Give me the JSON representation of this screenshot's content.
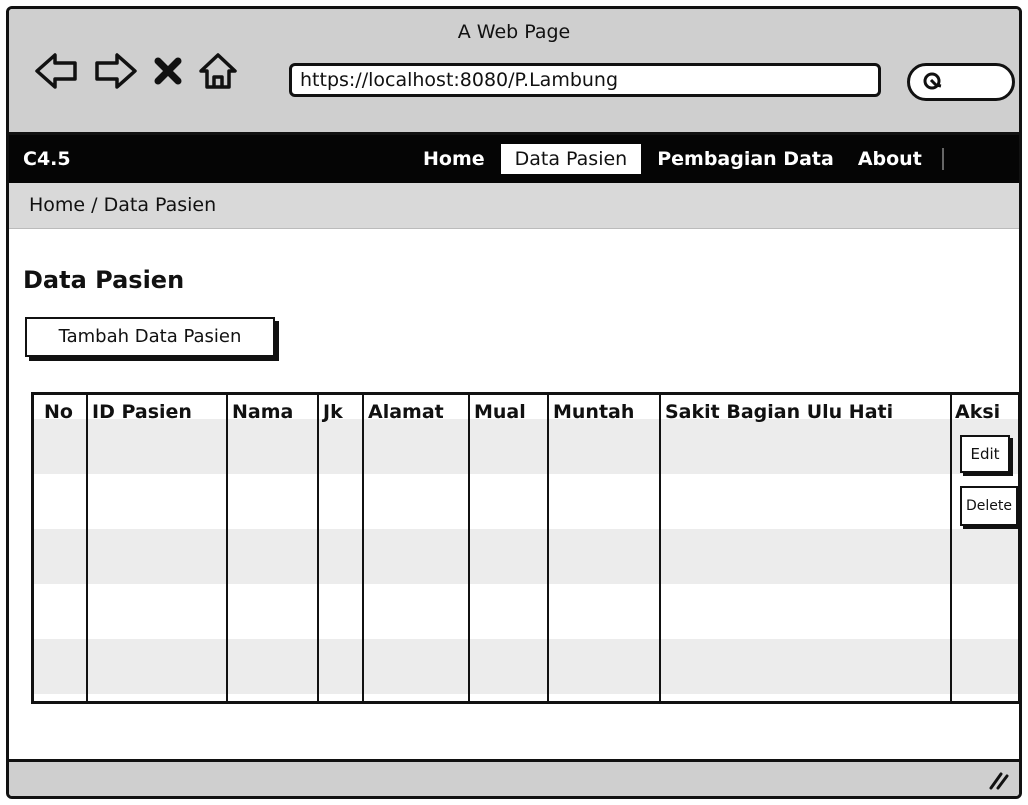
{
  "window": {
    "title": "A Web Page"
  },
  "browser": {
    "url": "https://localhost:8080/P.Lambung",
    "icons": [
      "back-arrow-icon",
      "forward-arrow-icon",
      "close-x-icon",
      "home-icon",
      "search-icon"
    ]
  },
  "navbar": {
    "brand": "C4.5",
    "items": [
      {
        "label": "Home",
        "active": false
      },
      {
        "label": "Data Pasien",
        "active": true
      },
      {
        "label": "Pembagian Data",
        "active": false
      },
      {
        "label": "About",
        "active": false
      }
    ]
  },
  "breadcrumb": {
    "text": "Home /  Data Pasien"
  },
  "page": {
    "title": "Data Pasien",
    "add_button": "Tambah Data Pasien"
  },
  "table": {
    "columns": [
      "No",
      "ID Pasien",
      "Nama",
      "Jk",
      "Alamat",
      "Mual",
      "Muntah",
      "Sakit Bagian Ulu Hati",
      "Aksi"
    ],
    "actions": {
      "edit": "Edit",
      "delete": "Delete"
    }
  }
}
